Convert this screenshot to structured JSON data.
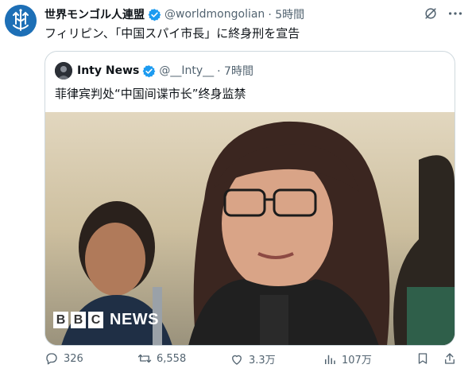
{
  "tweet": {
    "author_name": "世界モンゴル人連盟",
    "handle": "@worldmongolian",
    "time": "· 5時間",
    "text": "フィリピン、「中国スパイ市長」に終身刑を宣告"
  },
  "quoted": {
    "author_name": "Inty News",
    "handle": "@__Inty__",
    "time": "· 7時間",
    "text": "菲律宾判处“中国间谍市长”终身监禁",
    "image_watermark": {
      "b1": "B",
      "b2": "B",
      "b3": "C",
      "news": "NEWS"
    }
  },
  "actions": {
    "reply_count": "326",
    "retweet_count": "6,558",
    "like_count": "3.3万",
    "view_count": "107万"
  },
  "icons": {
    "verified": "verified-badge-icon",
    "grok": "grok-icon",
    "more": "more-icon",
    "reply": "reply-icon",
    "retweet": "retweet-icon",
    "like": "like-icon",
    "views": "views-icon",
    "bookmark": "bookmark-icon",
    "share": "share-icon"
  },
  "colors": {
    "verified": "#1d9bf0",
    "muted": "#536471",
    "border": "#cfd9de",
    "avatar_bg": "#1d6fb6"
  }
}
